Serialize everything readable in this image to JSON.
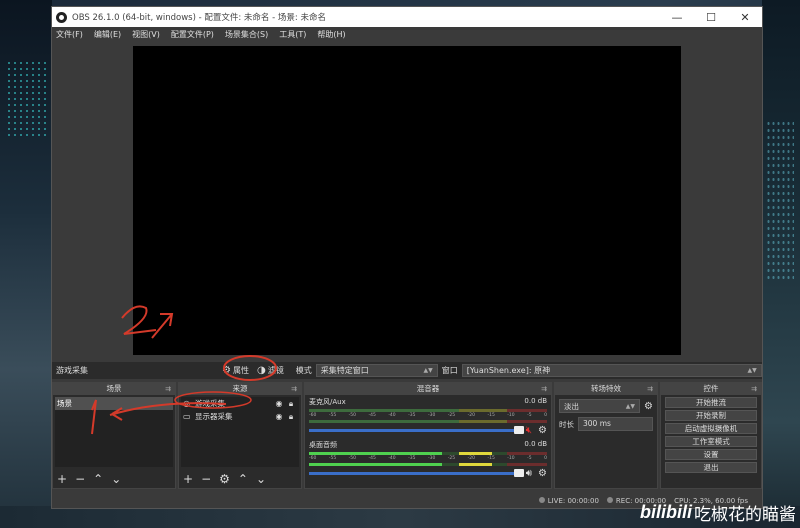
{
  "window": {
    "title": "OBS 26.1.0 (64-bit, windows) - 配置文件: 未命名 - 场景: 未命名",
    "minimize": "—",
    "maximize": "☐",
    "close": "✕"
  },
  "menu": [
    "文件(F)",
    "编辑(E)",
    "视图(V)",
    "配置文件(P)",
    "场景集合(S)",
    "工具(T)",
    "帮助(H)"
  ],
  "source_bar": {
    "selected_source": "游戏采集",
    "properties": "属性",
    "filters": "滤镜",
    "mode_label": "模式",
    "mode_value": "采集特定窗口",
    "window_label": "窗口",
    "window_value": "[YuanShen.exe]: 原神"
  },
  "scenes": {
    "header": "场景",
    "items": [
      "场景"
    ]
  },
  "sources": {
    "header": "来源",
    "items": [
      {
        "name": "游戏采集",
        "icon": "gamepad-icon"
      },
      {
        "name": "显示器采集",
        "icon": "monitor-icon"
      }
    ]
  },
  "mixer": {
    "header": "混音器",
    "channels": [
      {
        "name": "麦克风/Aux",
        "db": "0.0 dB",
        "muted": true
      },
      {
        "name": "桌面音频",
        "db": "0.0 dB",
        "muted": false
      }
    ],
    "ticks": [
      "-60",
      "-55",
      "-50",
      "-45",
      "-40",
      "-35",
      "-30",
      "-25",
      "-20",
      "-15",
      "-10",
      "-5",
      "0"
    ]
  },
  "transitions": {
    "header": "转场特效",
    "type": "淡出",
    "duration_label": "时长",
    "duration_value": "300 ms"
  },
  "controls": {
    "header": "控件",
    "buttons": [
      "开始推流",
      "开始录制",
      "启动虚拟摄像机",
      "工作室模式",
      "设置",
      "退出"
    ]
  },
  "status": {
    "live": "LIVE: 00:00:00",
    "rec": "REC: 00:00:00",
    "cpu": "CPU: 2.3%, 60.00 fps"
  },
  "watermark": {
    "logo": "bilibili",
    "user": "吃椒花的瞄酱"
  },
  "colors": {
    "annotation": "#d43a2a",
    "slider": "#3a6ec8",
    "muted": "#e03030"
  }
}
